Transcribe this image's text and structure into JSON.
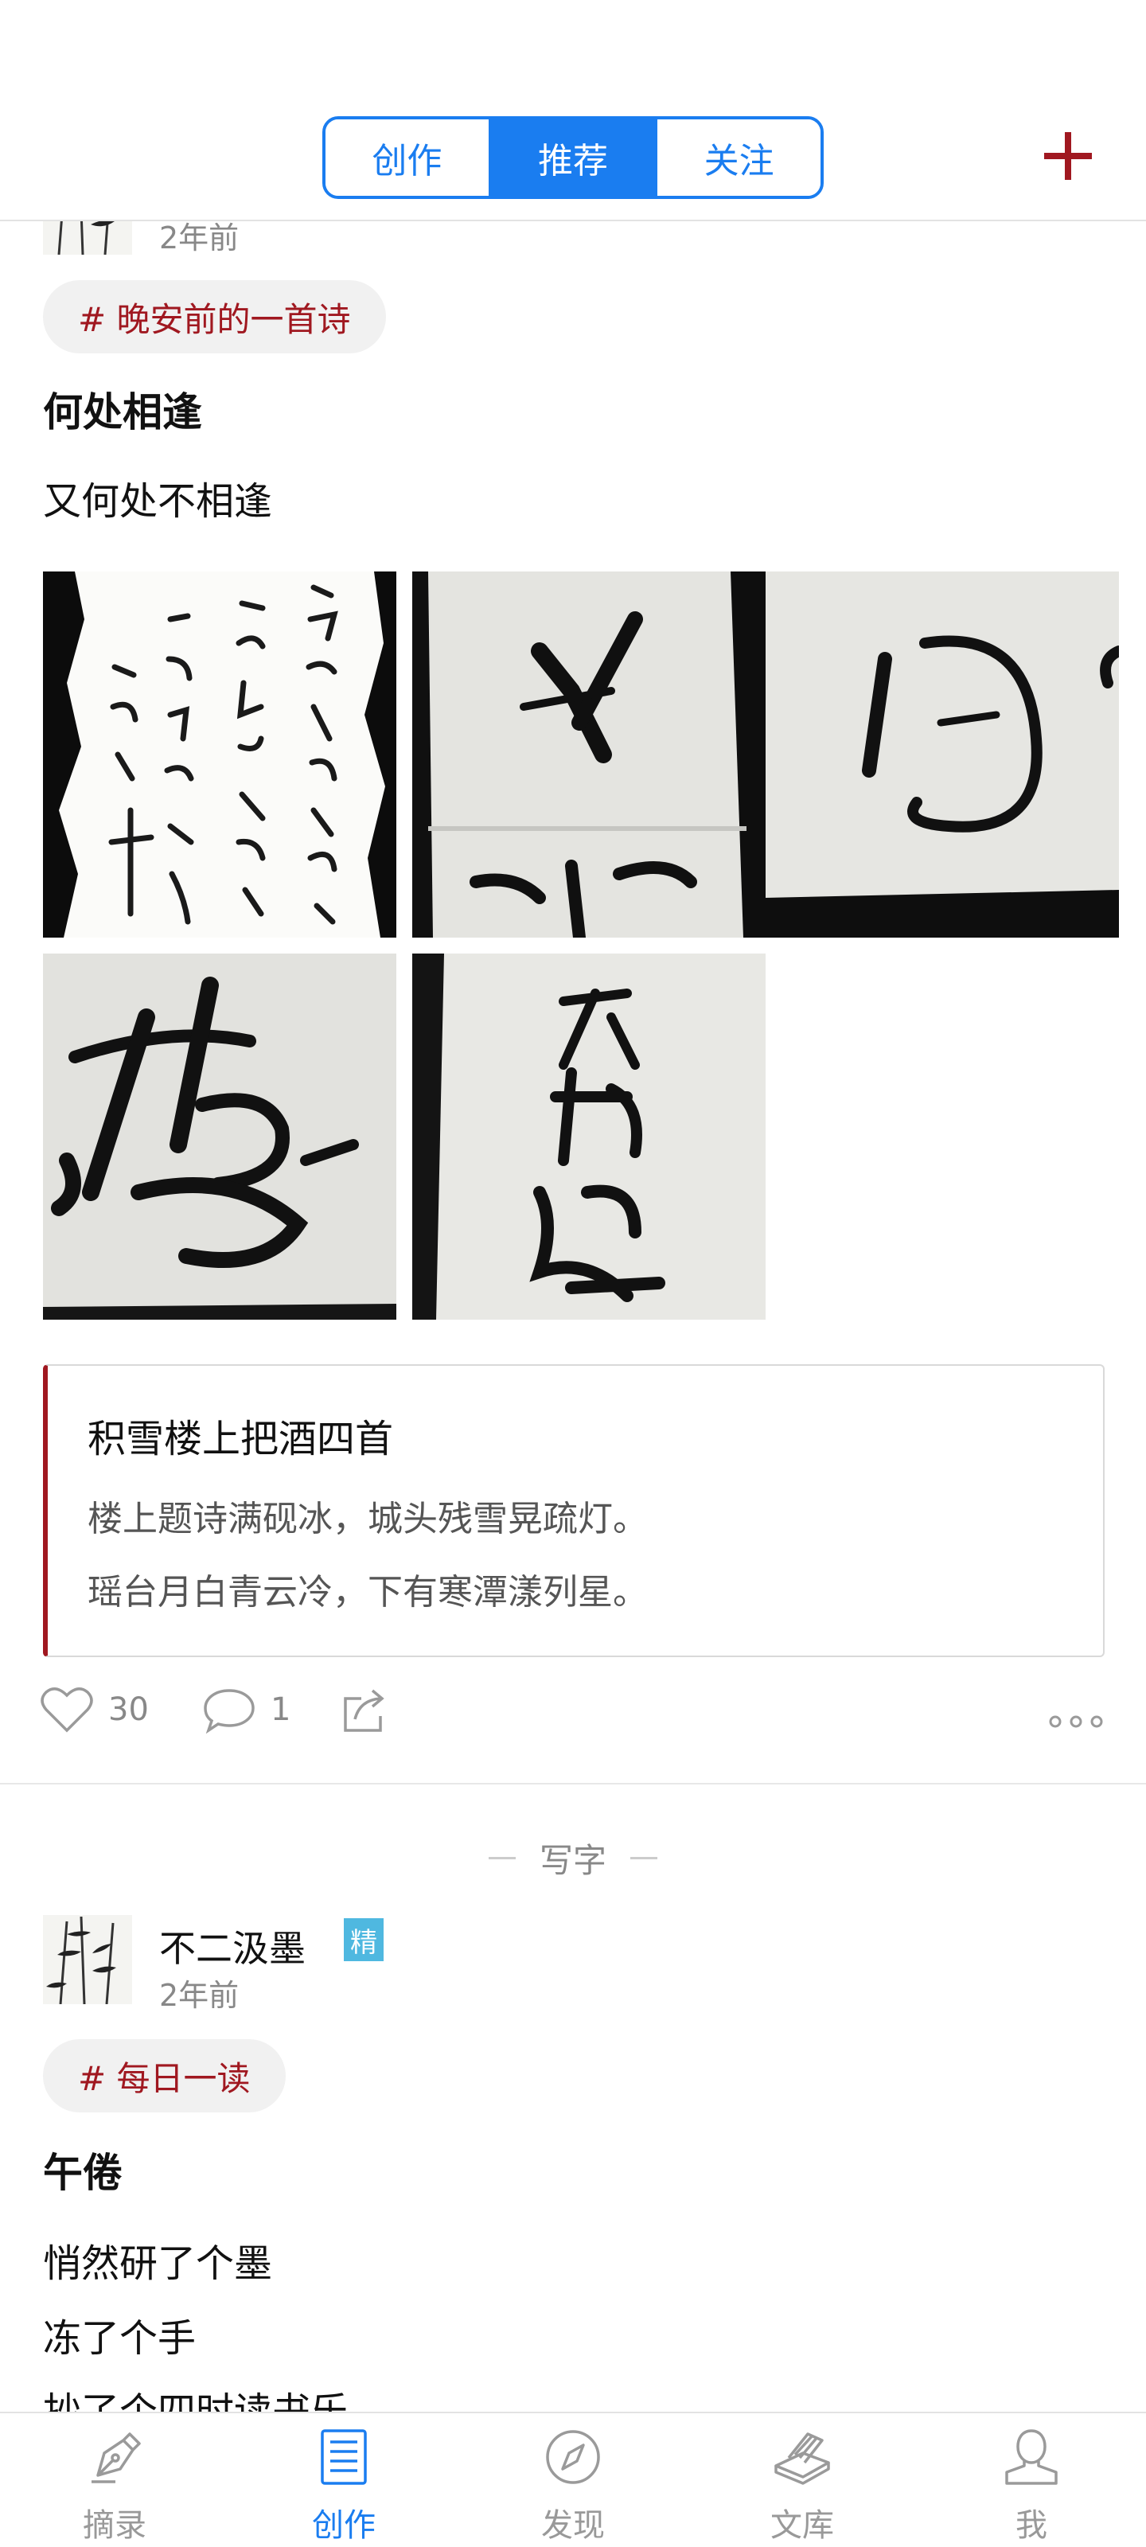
{
  "header": {
    "tabs": [
      {
        "label": "创作",
        "active": false
      },
      {
        "label": "推荐",
        "active": true
      },
      {
        "label": "关注",
        "active": false
      }
    ],
    "add_icon": "plus-icon"
  },
  "posts": [
    {
      "time": "2年前",
      "tag": "# 晚安前的一首诗",
      "title": "何处相逢",
      "lines": [
        "又何处不相逢"
      ],
      "quote": {
        "title": "积雪楼上把酒四首",
        "lines": [
          "楼上题诗满砚冰，城头残雪晃疏灯。",
          "瑶台月白青云冷，下有寒潭漾列星。"
        ]
      },
      "likes": "30",
      "comments": "1"
    },
    {
      "section": "写字",
      "author": "不二汲墨",
      "badge": "精",
      "time": "2年前",
      "tag": "# 每日一读",
      "title": "午倦",
      "lines": [
        "悄然研了个墨",
        "冻了个手",
        "抄了个四时读书乐"
      ]
    }
  ],
  "bottom_nav": [
    {
      "label": "摘录",
      "icon": "pen-nib-icon",
      "active": false
    },
    {
      "label": "创作",
      "icon": "document-icon",
      "active": true
    },
    {
      "label": "发现",
      "icon": "compass-icon",
      "active": false
    },
    {
      "label": "文库",
      "icon": "books-icon",
      "active": false
    },
    {
      "label": "我",
      "icon": "person-icon",
      "active": false
    }
  ],
  "colors": {
    "accent": "#1a7df0",
    "brand_red": "#a01820",
    "badge": "#4fb8e0"
  }
}
